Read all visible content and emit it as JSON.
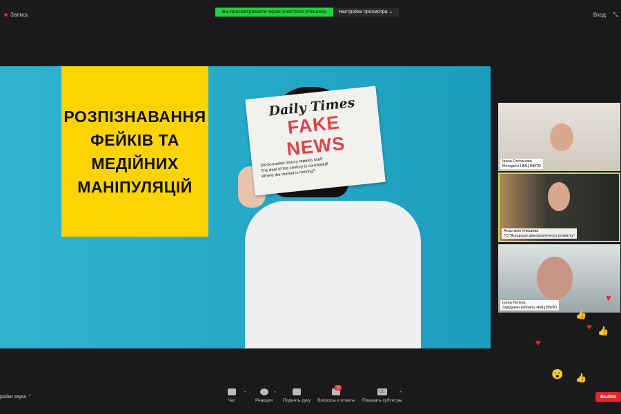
{
  "top": {
    "recording": "Запись",
    "viewing_banner": "Вы просматриваете экран Анастасія Улюшева",
    "view_settings": "Настройки просмотра",
    "exit": "Вход"
  },
  "slide": {
    "title_lines": [
      "РОЗПІЗНАВАННЯ",
      "ФЕЙКІВ ТА",
      "МЕДІЙНИХ",
      "МАНІПУЛЯЦІЙ"
    ],
    "newspaper": {
      "masthead": "Daily Times",
      "headline": "FAKE NEWS",
      "line1": "Stock-market history repeats itself",
      "line2": "The deal of the century is concluded!",
      "line3": "Where the market is moving?"
    }
  },
  "participants": [
    {
      "name": "Ірина Степанова",
      "role": "Методист НМЦ ВФПО"
    },
    {
      "name": "Анастасія Улюшева",
      "role": "ГО \"Асоціація демократичного розвитку\""
    },
    {
      "name": "Ірина Лепеха",
      "role": "Завідувач кабінету НМЦ ВФПО"
    }
  ],
  "toolbar": {
    "audio": "ройки звука",
    "chat": "Чат",
    "reactions": "Реакции",
    "raise_hand": "Поднять руку",
    "qa": "Вопросы и ответы",
    "qa_badge": "12",
    "captions": "Показать субтитры",
    "cc": "CC",
    "leave": "Выйти"
  }
}
